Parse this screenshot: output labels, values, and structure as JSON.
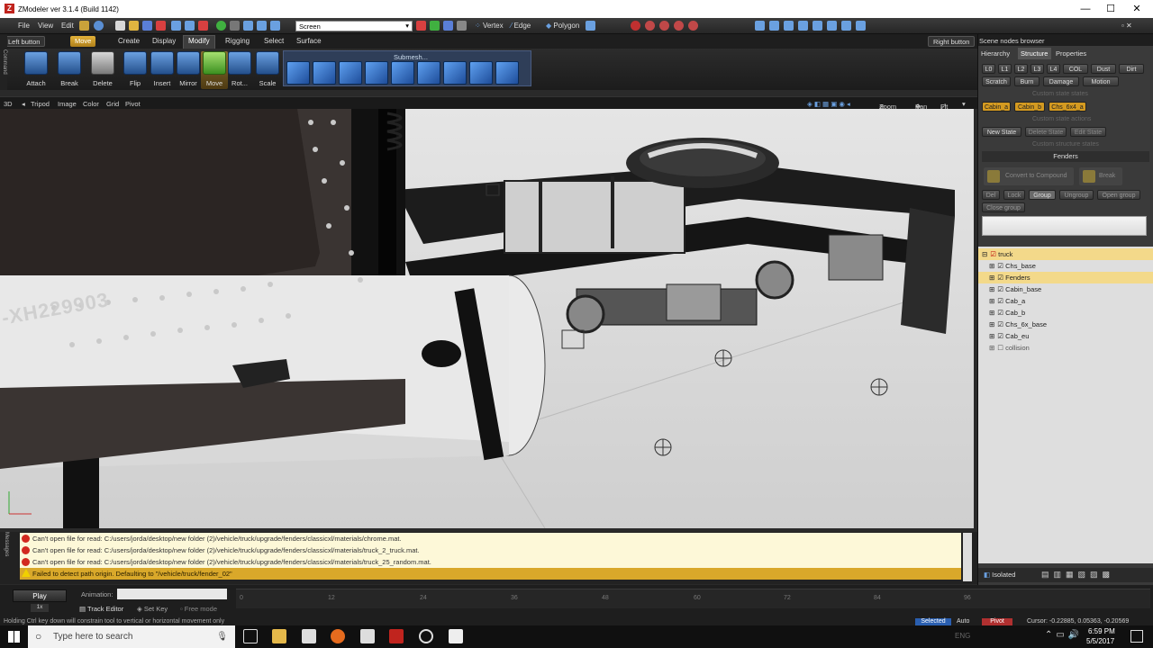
{
  "window": {
    "title": "ZModeler ver 3.1.4 (Build 1142)",
    "icon": "z-icon",
    "controls": [
      "—",
      "☐",
      "✕"
    ]
  },
  "menu": {
    "file": "File",
    "view": "View",
    "edit": "Edit",
    "coord_select": "Screen",
    "vertex": "Vertex",
    "edge": "Edge",
    "polygon": "Polygon"
  },
  "tabs": {
    "left_button": "Left button",
    "move": "Move",
    "items": [
      "Create",
      "Display",
      "Modify",
      "Rigging",
      "Select",
      "Surface"
    ],
    "active": "Modify",
    "right_button": "Right button"
  },
  "toolbar": {
    "tools": [
      "Attach",
      "Break",
      "Delete",
      "Flip",
      "Insert",
      "Mirror",
      "Move",
      "Rot...",
      "Scale"
    ],
    "active_tool": "Move",
    "submesh_label": "Submesh..."
  },
  "viewport": {
    "mode": "3D",
    "items": [
      "Tripod",
      "Image",
      "Color",
      "Grid",
      "Pivot"
    ],
    "nav": [
      "Zoom",
      "Pan",
      "Fit"
    ],
    "plate_text": "-XH229903",
    "side_label": "Command"
  },
  "panel": {
    "title": "Scene nodes browser",
    "tabs": [
      "Hierarchy",
      "Structure",
      "Properties"
    ],
    "active_tab": "Structure",
    "lod_buttons": [
      "L0",
      "L1",
      "L2",
      "L3",
      "L4",
      "COL",
      "Dust",
      "Dirt"
    ],
    "state_buttons": [
      "Scratch",
      "Burn",
      "Damage",
      "Motion"
    ],
    "section_states": "Custom state states",
    "state_tags": [
      "Cabin_a",
      "Cabin_b",
      "Chs_6x4_a"
    ],
    "section_actions": "Custom state actions",
    "action_buttons": [
      "New State",
      "Delete State",
      "Edit State"
    ],
    "section_structure": "Custom structure states",
    "group_name": "Fenders",
    "compound_buttons": [
      "Convert to Compound",
      "Break"
    ],
    "group_buttons": [
      "Del",
      "Lock",
      "Group",
      "Ungroup",
      "Open group",
      "Close group"
    ],
    "tree": [
      {
        "label": "truck",
        "checked": true,
        "selected": true,
        "level": 0
      },
      {
        "label": "Chs_base",
        "checked": true,
        "selected": false,
        "level": 1
      },
      {
        "label": "Fenders",
        "checked": true,
        "selected": true,
        "level": 1
      },
      {
        "label": "Cabin_base",
        "checked": true,
        "selected": false,
        "level": 1
      },
      {
        "label": "Cab_a",
        "checked": true,
        "selected": false,
        "level": 1
      },
      {
        "label": "Cab_b",
        "checked": true,
        "selected": false,
        "level": 1
      },
      {
        "label": "Chs_6x_base",
        "checked": true,
        "selected": false,
        "level": 1
      },
      {
        "label": "Cab_eu",
        "checked": true,
        "selected": false,
        "level": 1
      },
      {
        "label": "collision",
        "checked": false,
        "selected": false,
        "level": 1
      }
    ],
    "footer_label": "Isolated"
  },
  "log": {
    "side_label": "Messages",
    "lines": [
      {
        "type": "error",
        "text": "Can't open file for read: C:/users/jorda/desktop/new folder (2)/vehicle/truck/upgrade/fenders/classicxl/materials/chrome.mat."
      },
      {
        "type": "error",
        "text": "Can't open file for read: C:/users/jorda/desktop/new folder (2)/vehicle/truck/upgrade/fenders/classicxl/materials/truck_2_truck.mat."
      },
      {
        "type": "error",
        "text": "Can't open file for read: C:/users/jorda/desktop/new folder (2)/vehicle/truck/upgrade/fenders/classicxl/materials/truck_25_random.mat."
      },
      {
        "type": "warning",
        "text": "Failed to detect path origin. Defaulting to \"/vehicle/truck/fender_02\""
      }
    ]
  },
  "timeline": {
    "play": "Play",
    "speed": "1x",
    "animation_label": "Animation:",
    "ticks": [
      "0",
      "12",
      "24",
      "36",
      "48",
      "60",
      "72",
      "84",
      "96"
    ],
    "track_editor": "Track Editor",
    "set_key": "Set Key",
    "free_mode": "Free mode",
    "status_left": "Holding Ctrl key down will constrain tool to vertical or horizontal movement only",
    "status_selected": "Selected",
    "status_auto": "Auto",
    "status_pivot": "Pivot",
    "cursor": "Cursor: -0.22885, 0.05363, -0.20569"
  },
  "taskbar": {
    "search_placeholder": "Type here to search",
    "time": "6:59 PM",
    "date": "5/5/2017",
    "overlay": "ENG"
  }
}
